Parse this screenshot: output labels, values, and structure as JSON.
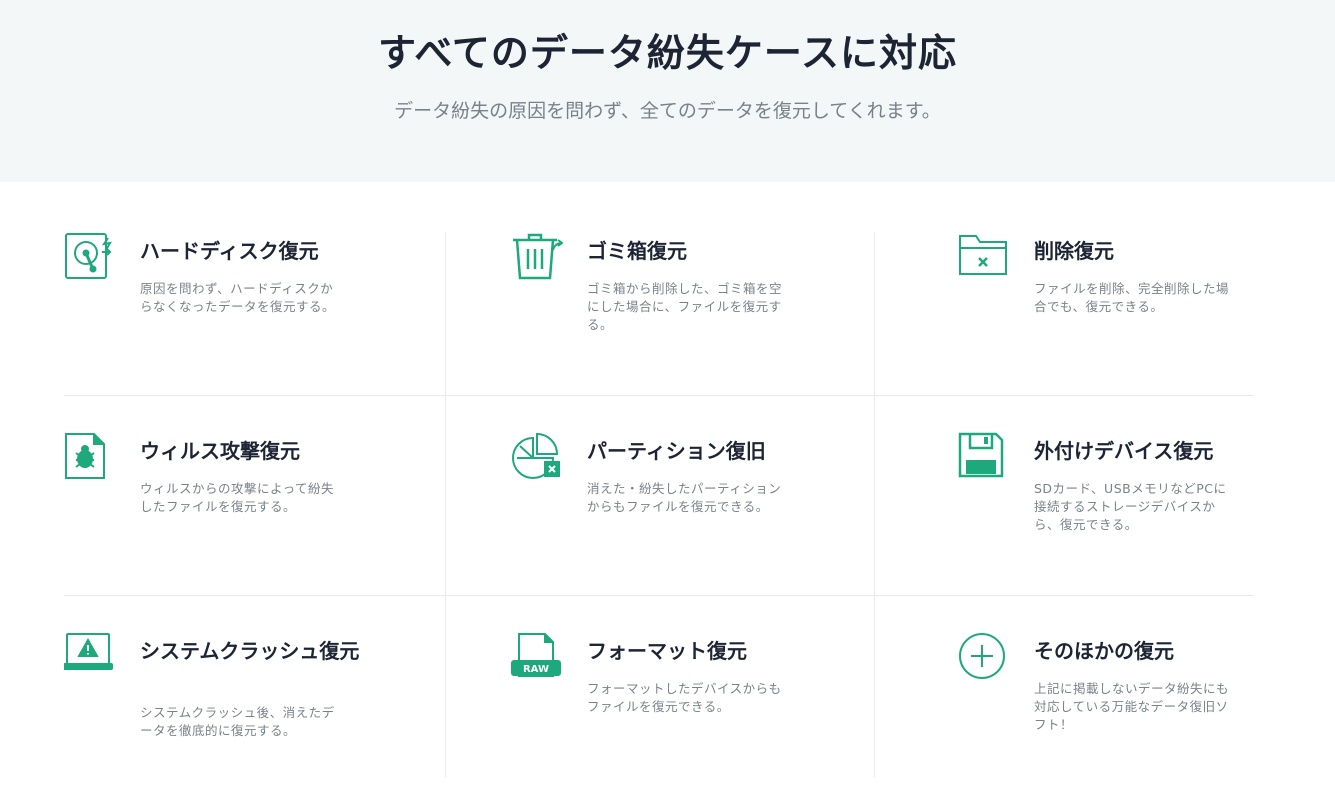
{
  "header": {
    "title": "すべてのデータ紛失ケースに対応",
    "subtitle": "データ紛失の原因を問わず、全てのデータを復元してくれます。"
  },
  "colors": {
    "accent": "#1ea97c",
    "text": "#1d2433",
    "muted": "#7b818b",
    "hero_bg": "#f4f7f8"
  },
  "cards": [
    {
      "icon": "hard-disk-icon",
      "title": "ハードディスク復元",
      "description": "原因を問わず、ハードディスクからなくなったデータを復元する。"
    },
    {
      "icon": "trash-bin-icon",
      "title": "ゴミ箱復元",
      "description": "ゴミ箱から削除した、ゴミ箱を空にした場合に、ファイルを復元する。"
    },
    {
      "icon": "deleted-folder-icon",
      "title": "削除復元",
      "description": "ファイルを削除、完全削除した場合でも、復元できる。"
    },
    {
      "icon": "virus-file-icon",
      "title": "ウィルス攻撃復元",
      "description": "ウィルスからの攻撃によって紛失したファイルを復元する。"
    },
    {
      "icon": "partition-icon",
      "title": "パーティション復旧",
      "description": "消えた・紛失したパーティションからもファイルを復元できる。"
    },
    {
      "icon": "external-device-icon",
      "title": "外付けデバイス復元",
      "description": "SDカード、USBメモリなどPCに接続するストレージデバイスから、復元できる。"
    },
    {
      "icon": "system-crash-icon",
      "title": "システムクラッシュ復元",
      "description": "システムクラッシュ後、消えたデータを徹底的に復元する。"
    },
    {
      "icon": "raw-format-icon",
      "title": "フォーマット復元",
      "description": "フォーマットしたデバイスからもファイルを復元できる。"
    },
    {
      "icon": "plus-circle-icon",
      "title": "そのほかの復元",
      "description": "上記に掲載しないデータ紛失にも対応している万能なデータ復旧ソフト！"
    }
  ]
}
